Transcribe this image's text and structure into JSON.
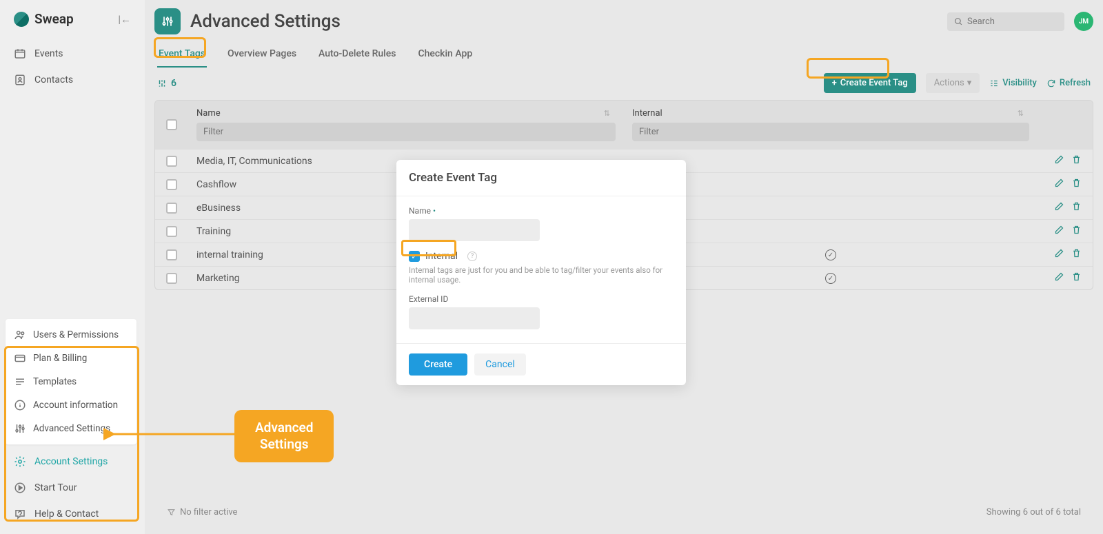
{
  "brand": "Sweap",
  "sidebar": {
    "main_nav": [
      {
        "label": "Events",
        "icon": "events"
      },
      {
        "label": "Contacts",
        "icon": "contacts"
      }
    ],
    "submenu": [
      {
        "label": "Users & Permissions",
        "icon": "users"
      },
      {
        "label": "Plan & Billing",
        "icon": "billing"
      },
      {
        "label": "Templates",
        "icon": "templates"
      },
      {
        "label": "Account information",
        "icon": "info"
      },
      {
        "label": "Advanced Settings",
        "icon": "sliders"
      }
    ],
    "bottom_nav": [
      {
        "label": "Account Settings",
        "icon": "gear",
        "active": true
      },
      {
        "label": "Start Tour",
        "icon": "play"
      },
      {
        "label": "Help & Contact",
        "icon": "help"
      }
    ]
  },
  "page": {
    "title": "Advanced Settings",
    "search_placeholder": "Search",
    "avatar": "JM"
  },
  "tabs": [
    {
      "label": "Event Tags",
      "active": true
    },
    {
      "label": "Overview Pages"
    },
    {
      "label": "Auto-Delete Rules"
    },
    {
      "label": "Checkin App"
    }
  ],
  "toolbar": {
    "count": "6",
    "create_label": "Create Event Tag",
    "actions_label": "Actions",
    "visibility_label": "Visibility",
    "refresh_label": "Refresh"
  },
  "table": {
    "col_name": "Name",
    "col_internal": "Internal",
    "filter_placeholder": "Filter",
    "rows": [
      {
        "name": "Media, IT, Communications",
        "internal": false
      },
      {
        "name": "Cashflow",
        "internal": false
      },
      {
        "name": "eBusiness",
        "internal": false
      },
      {
        "name": "Training",
        "internal": false
      },
      {
        "name": "internal training",
        "internal": true
      },
      {
        "name": "Marketing",
        "internal": true
      }
    ]
  },
  "footer": {
    "no_filter": "No filter active",
    "showing": "Showing 6 out of 6 total"
  },
  "modal": {
    "title": "Create Event Tag",
    "name_label": "Name",
    "internal_label": "Internal",
    "internal_help": "Internal tags are just for you and be able to tag/filter your events also for internal usage.",
    "external_id_label": "External ID",
    "create_btn": "Create",
    "cancel_btn": "Cancel"
  },
  "callout": "Advanced\nSettings"
}
